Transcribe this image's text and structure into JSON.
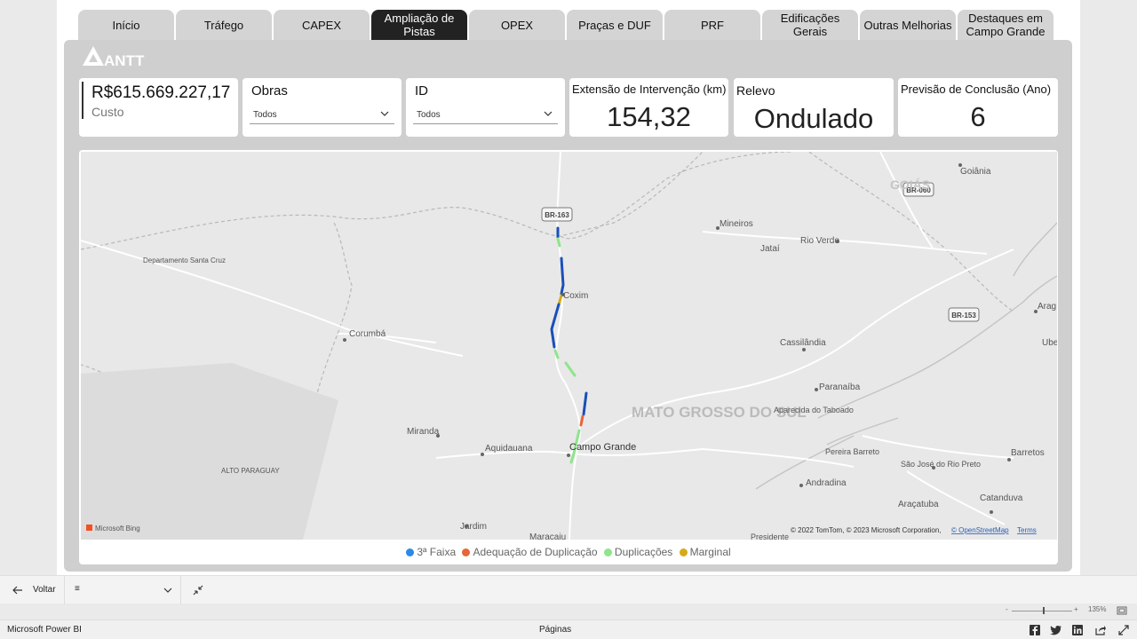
{
  "tabs": [
    {
      "label": "Início",
      "active": false
    },
    {
      "label": "Tráfego",
      "active": false
    },
    {
      "label": "CAPEX",
      "active": false
    },
    {
      "label": "Ampliação de Pistas",
      "active": true
    },
    {
      "label": "OPEX",
      "active": false
    },
    {
      "label": "Praças e DUF",
      "active": false
    },
    {
      "label": "PRF",
      "active": false
    },
    {
      "label": "Edificações Gerais",
      "active": false
    },
    {
      "label": "Outras Melhorias",
      "active": false
    },
    {
      "label": "Destaques em Campo Grande",
      "active": false
    }
  ],
  "logo": {
    "text": "ANTT"
  },
  "kpi_cost": {
    "value": "R$615.669.227,17",
    "label": "Custo"
  },
  "filter_obras": {
    "title": "Obras",
    "selected": "Todos"
  },
  "filter_id": {
    "title": "ID",
    "selected": "Todos"
  },
  "card_extensao": {
    "title": "Extensão de Intervenção (km)",
    "value": "154,32"
  },
  "card_relevo": {
    "title": "Relevo",
    "value": "Ondulado"
  },
  "card_previsao": {
    "title": "Previsão de Conclusão (Ano)",
    "value": "6"
  },
  "map": {
    "state_label": "MATO GROSSO DO SUL",
    "places": {
      "goiania": "Goiânia",
      "goias": "GOIÁS",
      "mineiros": "Mineiros",
      "jatai": "Jataí",
      "rio_verde": "Rio Verde",
      "santa_cruz": "Departamento Santa Cruz",
      "corumba": "Corumbá",
      "coxim": "Coxim",
      "cassilandia": "Cassilândia",
      "paranaiba": "Paranaíba",
      "aparecida": "Aparecida do Taboado",
      "miranda": "Miranda",
      "aquidauana": "Aquidauana",
      "campo_grande": "Campo Grande",
      "alto_paraguay": "ALTO PARAGUAY",
      "pereira_barreto": "Pereira Barreto",
      "sao_jose": "São José do Rio Preto",
      "barretos": "Barretos",
      "andradina": "Andradina",
      "aracatuba": "Araçatuba",
      "catanduva": "Catanduva",
      "jardim": "Jardim",
      "maracaju": "Maracaju",
      "presidente": "Presidente",
      "arag": "Arag",
      "uberl": "Uberl"
    },
    "shields": {
      "br163": "BR-163",
      "br060": "BR-060",
      "br153": "BR-153"
    },
    "attribution": "© 2022 TomTom, © 2023 Microsoft Corporation,",
    "osm_link": "© OpenStreetMap",
    "terms_link": "Terms",
    "bing": "Microsoft Bing"
  },
  "legend": [
    {
      "label": "3ª Faixa",
      "color": "#2b8ae8"
    },
    {
      "label": "Adequação de Duplicação",
      "color": "#e8643a"
    },
    {
      "label": "Duplicações",
      "color": "#8ee58a"
    },
    {
      "label": "Marginal",
      "color": "#d6aa18"
    }
  ],
  "bottom": {
    "back_label": "Voltar",
    "page_selector": "≡"
  },
  "zoom": {
    "value": "135%"
  },
  "status": {
    "app_name": "Microsoft Power BI",
    "pages_label": "Páginas"
  }
}
